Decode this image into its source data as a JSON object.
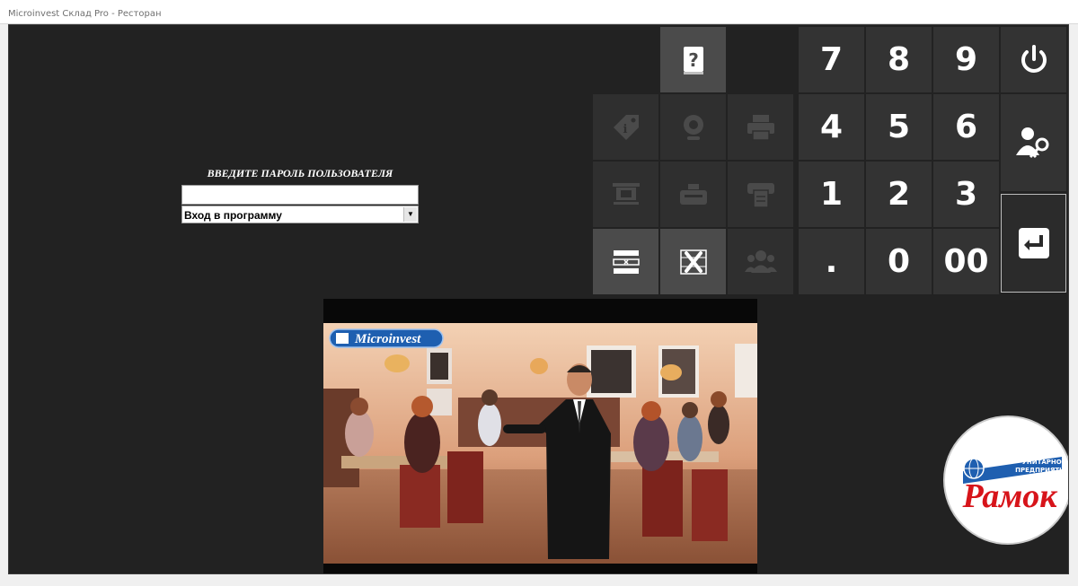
{
  "window": {
    "title": "Microinvest Склад Pro - Ресторан"
  },
  "login": {
    "prompt": "ВВЕДИТЕ ПАРОЛЬ ПОЛЬЗОВАТЕЛЯ",
    "password_value": "",
    "mode_selected": "Вход в программу"
  },
  "keypad": {
    "keys": [
      "7",
      "8",
      "9",
      "4",
      "5",
      "6",
      "1",
      "2",
      "3",
      ".",
      "0",
      "00"
    ]
  },
  "function_tiles": [
    {
      "icon": "help-book-icon",
      "enabled": true
    },
    {
      "icon": "price-tag-info-icon",
      "enabled": false
    },
    {
      "icon": "webcam-icon",
      "enabled": false
    },
    {
      "icon": "printer-icon",
      "enabled": false
    },
    {
      "icon": "cash-display-icon",
      "enabled": false
    },
    {
      "icon": "fiscal-printer-icon",
      "enabled": false
    },
    {
      "icon": "receipt-printer-icon",
      "enabled": false
    },
    {
      "icon": "delete-line-icon",
      "enabled": true
    },
    {
      "icon": "clear-all-icon",
      "enabled": true
    },
    {
      "icon": "users-group-icon",
      "enabled": false
    }
  ],
  "side_buttons": [
    "power-icon",
    "user-key-icon",
    "enter-icon"
  ],
  "video": {
    "logo_text": "Microinvest"
  },
  "badge": {
    "top_line1": "УНИТАРНОЕ",
    "top_line2": "ПРЕДПРИЯТИЕ",
    "brand": "Рамок"
  },
  "colors": {
    "background": "#222222",
    "tile_active": "#4b4b4b",
    "tile_inactive": "#2f2f2f",
    "badge_red": "#d7141a",
    "badge_blue": "#1f5fb0"
  }
}
